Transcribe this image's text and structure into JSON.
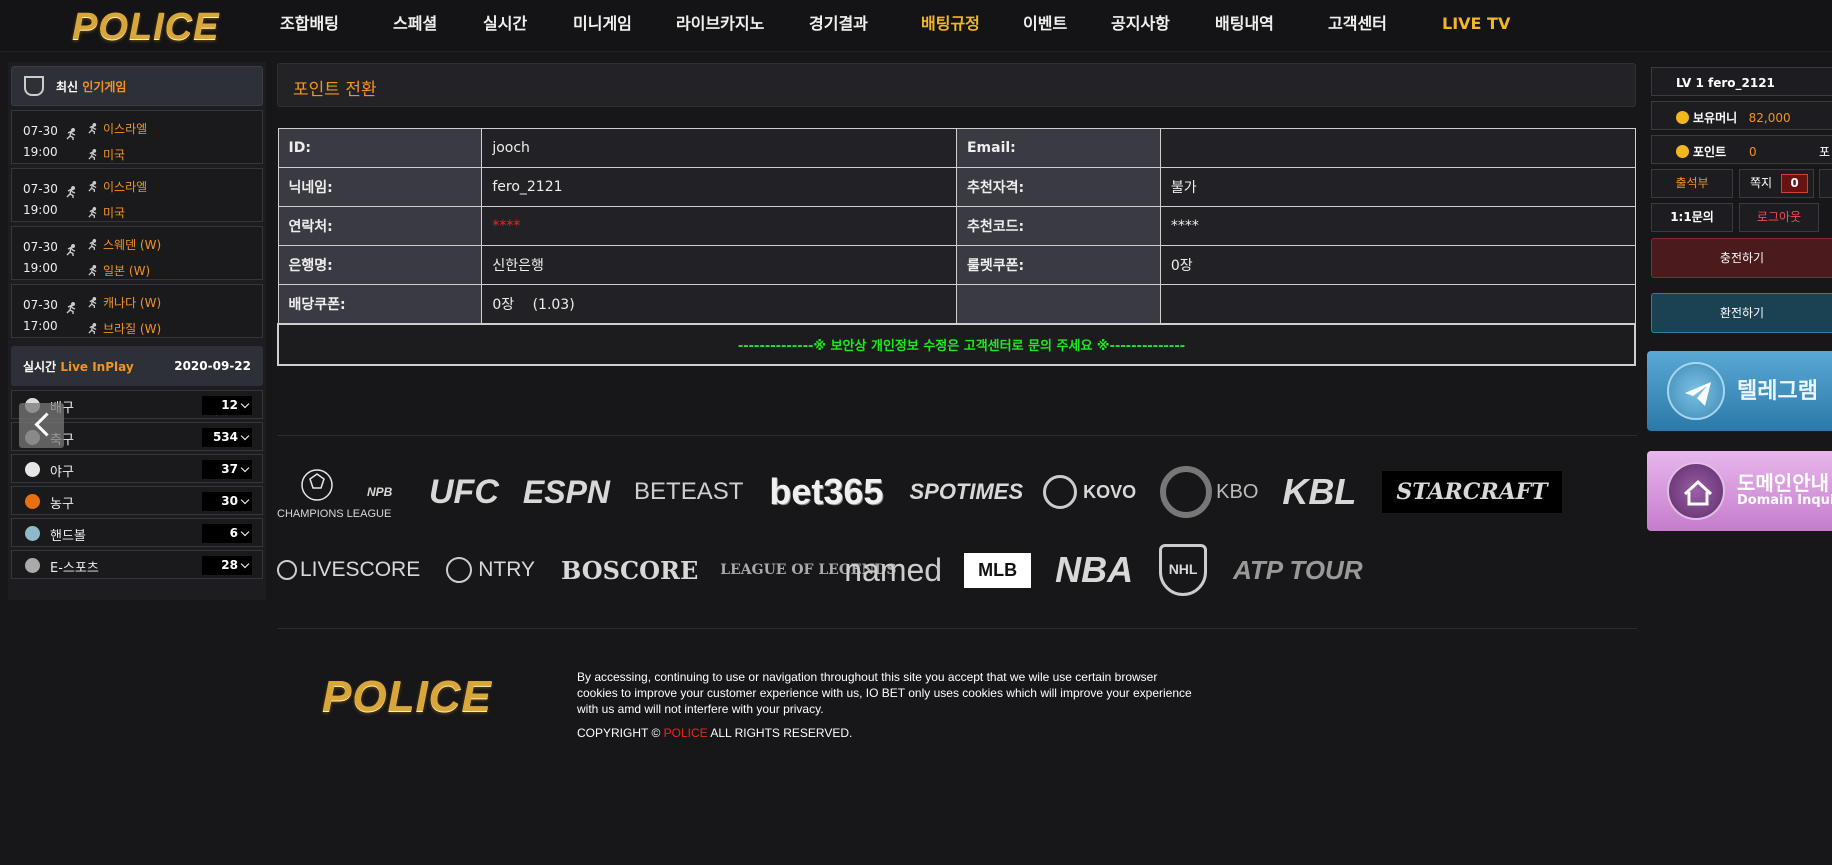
{
  "header": {
    "logo": "POLICE",
    "nav": [
      {
        "label": "조합배팅",
        "gold": false,
        "w": 113
      },
      {
        "label": "스페셜",
        "gold": false,
        "w": 90
      },
      {
        "label": "실시간",
        "gold": false,
        "w": 90
      },
      {
        "label": "미니게임",
        "gold": false,
        "w": 103
      },
      {
        "label": "라이브카지노",
        "gold": false,
        "w": 133
      },
      {
        "label": "경기결과",
        "gold": false,
        "w": 112
      },
      {
        "label": "배팅규정",
        "gold": true,
        "w": 102
      },
      {
        "label": "이벤트",
        "gold": false,
        "w": 88
      },
      {
        "label": "공지사항",
        "gold": false,
        "w": 104
      },
      {
        "label": "배팅내역",
        "gold": false,
        "w": 113
      },
      {
        "label": "고객센터",
        "gold": false,
        "w": 114
      },
      {
        "label": "LIVE TV",
        "gold": true,
        "w": 80
      }
    ]
  },
  "popular": {
    "title_white": "최신",
    "title_orange": "인기게임",
    "matches": [
      {
        "date": "07-30",
        "time": "19:00",
        "home": "이스라엘",
        "away": "미국"
      },
      {
        "date": "07-30",
        "time": "19:00",
        "home": "이스라엘",
        "away": "미국"
      },
      {
        "date": "07-30",
        "time": "19:00",
        "home": "스웨덴 (W)",
        "away": "일본 (W)"
      },
      {
        "date": "07-30",
        "time": "17:00",
        "home": "캐나다 (W)",
        "away": "브라질 (W)"
      }
    ]
  },
  "live": {
    "title_white": "실시간",
    "title_orange": "Live InPlay",
    "date": "2020-09-22",
    "sports": [
      {
        "name": "배구",
        "count": "12",
        "color": "#dcdcdc"
      },
      {
        "name": "축구",
        "count": "534",
        "color": "#bbbbbb"
      },
      {
        "name": "야구",
        "count": "37",
        "color": "#e6e6e6"
      },
      {
        "name": "농구",
        "count": "30",
        "color": "#e8700f"
      },
      {
        "name": "핸드볼",
        "count": "6",
        "color": "#8fb8c8"
      },
      {
        "name": "E-스포츠",
        "count": "28",
        "color": "#aaaaaa"
      }
    ]
  },
  "page": {
    "title": "포인트 전환",
    "rows": [
      [
        {
          "label": "ID:",
          "value": "jooch",
          "red": false
        },
        {
          "label": "Email:",
          "value": "",
          "red": false
        }
      ],
      [
        {
          "label": "닉네임:",
          "value": "fero_2121",
          "red": false
        },
        {
          "label": "추천자격:",
          "value": "불가",
          "red": false
        }
      ],
      [
        {
          "label": "연락처:",
          "value": "****",
          "red": true
        },
        {
          "label": "추천코드:",
          "value": "****",
          "red": false
        }
      ],
      [
        {
          "label": "은행명:",
          "value": "신한은행",
          "red": false
        },
        {
          "label": "룰렛쿠폰:",
          "value": "0장",
          "red": false
        }
      ],
      [
        {
          "label": "배당쿠폰:",
          "value": "0장 　(1.03)",
          "red": false
        },
        {
          "label": "",
          "value": "",
          "red": false
        }
      ]
    ],
    "notice": "--------------※ 보안상 개인정보 수정은 고객센터로 문의 주세요 ※--------------"
  },
  "logos_row1": [
    "CHAMPIONS LEAGUE",
    "NPB",
    "UFC",
    "ESPN",
    "BETEAST",
    "bet365",
    "SPOTIMES",
    "KOVO",
    "KBO",
    "KBL",
    "STARCRAFT"
  ],
  "logos_row2": [
    "LIVESCORE",
    "NTRY",
    "BOSCORE",
    "LEAGUE OF LEGENDS",
    "named",
    "MLB",
    "NBA",
    "NHL",
    "ATP TOUR"
  ],
  "footer": {
    "logo": "POLICE",
    "text": "By accessing, continuing to use or navigation throughout this site you accept that we wile use certain browser cookies to improve your customer experience with us, IO BET only uses cookies which will improve your experience with us amd will not interfere with your privacy.",
    "copy_pre": "COPYRIGHT © ",
    "copy_brand": "POLICE",
    "copy_post": " ALL RIGHTS RESERVED."
  },
  "user": {
    "level": "LV 1 fero_2121",
    "money_label": "보유머니",
    "money": "82,000",
    "point_label": "포인트",
    "point": "0",
    "point_cut": "포",
    "attendance": "출석부",
    "memo_label": "쪽지",
    "memo_count": "0",
    "inquiry": "1:1문의",
    "logout": "로그아웃",
    "charge": "충전하기",
    "exchange": "환전하기"
  },
  "banners": {
    "telegram": "텔레그램",
    "domain_ko": "도메인안내",
    "domain_en": "Domain Inquiry"
  }
}
